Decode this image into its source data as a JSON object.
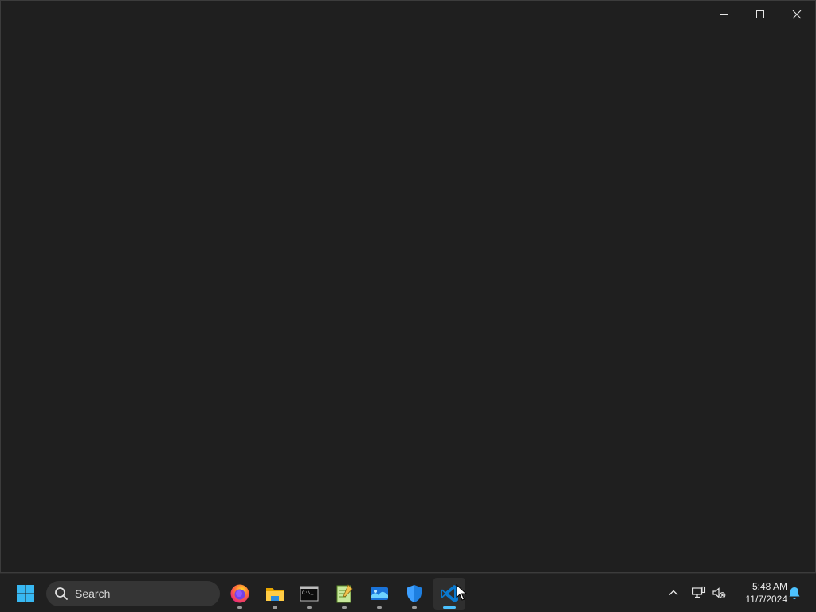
{
  "window": {
    "caption_buttons": [
      "minimize",
      "maximize",
      "close"
    ]
  },
  "taskbar": {
    "search": {
      "placeholder": "Search"
    },
    "pinned_apps": [
      {
        "name": "Firefox",
        "icon": "firefox-icon",
        "running": true
      },
      {
        "name": "File Explorer",
        "icon": "file-explorer-icon",
        "running": true
      },
      {
        "name": "Command Prompt",
        "icon": "terminal-icon",
        "running": true
      },
      {
        "name": "Notepad++",
        "icon": "notepad-icon",
        "running": true
      },
      {
        "name": "Photos",
        "icon": "photos-icon",
        "running": true
      },
      {
        "name": "Windows Security",
        "icon": "shield-icon",
        "running": true
      },
      {
        "name": "Visual Studio Code",
        "icon": "vscode-icon",
        "running": true,
        "active": true
      }
    ],
    "tray": {
      "time": "5:48 AM",
      "date": "11/7/2024"
    }
  },
  "colors": {
    "window_bg": "#1f1f1f",
    "taskbar_bg": "#202020",
    "accent": "#4cc2ff"
  }
}
